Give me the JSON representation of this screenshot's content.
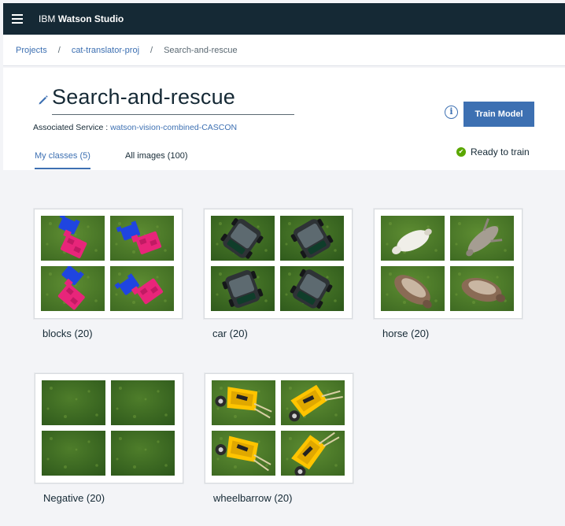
{
  "app": {
    "brand_prefix": "IBM",
    "brand_name": "Watson Studio"
  },
  "breadcrumb": {
    "items": [
      "Projects",
      "cat-translator-proj",
      "Search-and-rescue"
    ],
    "separator": "/"
  },
  "header": {
    "title": "Search-and-rescue",
    "assoc_label": "Associated Service :",
    "assoc_service": "watson-vision-combined-CASCON",
    "info_glyph": "i",
    "train_button": "Train Model",
    "status": "Ready to train",
    "status_color": "#5aa700",
    "accent_color": "#3d70b2"
  },
  "tabs": [
    {
      "label": "My classes (5)",
      "active": true
    },
    {
      "label": "All images (100)",
      "active": false
    }
  ],
  "classes": [
    {
      "name": "blocks (20)",
      "thumbs": [
        "blocks",
        "blocks",
        "blocks",
        "blocks"
      ]
    },
    {
      "name": "car (20)",
      "thumbs": [
        "car",
        "car",
        "car",
        "car"
      ]
    },
    {
      "name": "horse (20)",
      "thumbs": [
        "horse-white",
        "horse-grey",
        "horse-brown",
        "horse-brown"
      ]
    },
    {
      "name": "Negative (20)",
      "thumbs": [
        "grass",
        "grass",
        "grass",
        "grass"
      ]
    },
    {
      "name": "wheelbarrow (20)",
      "thumbs": [
        "wheelbarrow",
        "wheelbarrow",
        "wheelbarrow",
        "wheelbarrow"
      ]
    }
  ]
}
